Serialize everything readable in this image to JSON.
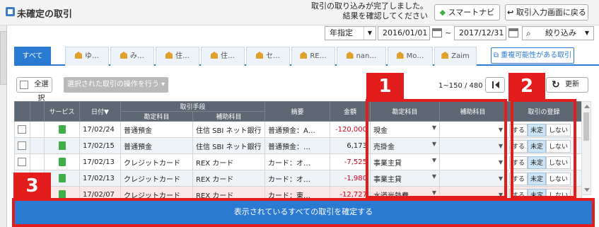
{
  "header": {
    "title": "未確定の取引",
    "notice_line1": "取引の取り込みが完了しました。",
    "notice_line2": "結果を確認してください",
    "navi_button": "スマートナビ",
    "return_button": "取引入力画面に戻る"
  },
  "filter": {
    "period_label": "年指定",
    "date_from": "2016/01/01",
    "tilde": "~",
    "date_to": "2017/12/31",
    "narrow_label": "絞り込み"
  },
  "tabs": [
    {
      "label": "すべて"
    },
    {
      "label": "ゆ…"
    },
    {
      "label": "み…"
    },
    {
      "label": "住…"
    },
    {
      "label": "住…"
    },
    {
      "label": "セ…"
    },
    {
      "label": "RE…"
    },
    {
      "label": "nan…"
    },
    {
      "label": "Mo…"
    },
    {
      "label": "Zaim"
    }
  ],
  "duplicate_button": "重複可能性がある取引",
  "toolbar": {
    "select_all": "全選択",
    "ops_button": "選択された取引の操作を行う ▾",
    "pager": "1~150 / 480",
    "refresh": "更新"
  },
  "columns": {
    "service": "サービス",
    "date": "日付▼",
    "method_group": "取引手段",
    "account": "勘定科目",
    "sub_account": "補助科目",
    "desc": "摘要",
    "amount": "金額",
    "acc2": "勘定科目",
    "sub2": "補助科目",
    "register": "取引の登録"
  },
  "rows": [
    {
      "date": "17/02/24",
      "account": "普通預金",
      "sub": "住信 SBI ネット銀行",
      "desc": "普通預金：A…",
      "amount": "-120,000",
      "acc2": "現金"
    },
    {
      "date": "17/02/15",
      "account": "普通預金",
      "sub": "住信 SBI ネット銀行",
      "desc": "普通預金：…",
      "amount": "6,173",
      "acc2": "売掛金"
    },
    {
      "date": "17/02/13",
      "account": "クレジットカード",
      "sub": "REX カード",
      "desc": "カード：オ…",
      "amount": "-7,525",
      "acc2": "事業主貸"
    },
    {
      "date": "17/02/13",
      "account": "クレジットカード",
      "sub": "REX カード",
      "desc": "カード：オ…",
      "amount": "-1,980",
      "acc2": "事業主貸"
    },
    {
      "date": "17/02/07",
      "account": "クレジットカード",
      "sub": "REX カード",
      "desc": "カード：東…",
      "amount": "-12,727",
      "acc2": "水道光熱費"
    }
  ],
  "register_options": {
    "yes": "する",
    "pending": "未定",
    "no": "しない"
  },
  "badges": {
    "b1": "1",
    "b2": "2",
    "b3": "3"
  },
  "confirm_all": "表示されているすべての取引を確定する",
  "colors": {
    "accent": "#2a7ad2",
    "highlight": "#e31c1c",
    "header_bg": "#5d6872"
  }
}
